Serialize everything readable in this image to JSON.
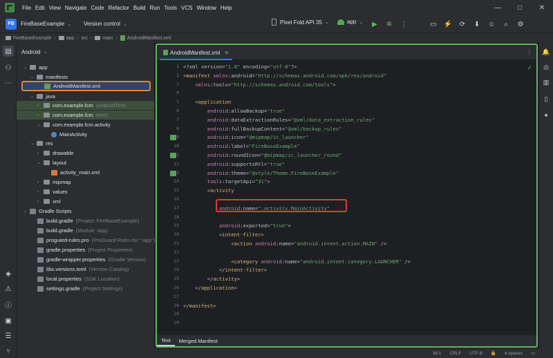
{
  "menu": [
    "File",
    "Edit",
    "View",
    "Navigate",
    "Code",
    "Refactor",
    "Build",
    "Run",
    "Tools",
    "VCS",
    "Window",
    "Help"
  ],
  "window_controls": {
    "minimize": "—",
    "maximize": "□",
    "close": "✕"
  },
  "toolbar": {
    "project_badge": "FB",
    "project_name": "FireBaseExample",
    "version_control": "Version control",
    "device": "Pixel Fold API 35",
    "run_config": "app"
  },
  "breadcrumb": [
    "FireBaseExample",
    "app",
    "src",
    "main",
    "AndroidManifest.xml"
  ],
  "project_panel": {
    "view_label": "Android",
    "tree": [
      {
        "label": "app",
        "hint": ""
      },
      {
        "label": "manifests",
        "hint": ""
      },
      {
        "label": "AndroidManifest.xml",
        "hint": ""
      },
      {
        "label": "java",
        "hint": ""
      },
      {
        "label": "com.example.fcm",
        "hint": "(androidTest)"
      },
      {
        "label": "com.example.fcm",
        "hint": "(test)"
      },
      {
        "label": "com.example.fcm.activity",
        "hint": ""
      },
      {
        "label": "MainActivity",
        "hint": ""
      },
      {
        "label": "res",
        "hint": ""
      },
      {
        "label": "drawable",
        "hint": ""
      },
      {
        "label": "layout",
        "hint": ""
      },
      {
        "label": "activity_main.xml",
        "hint": ""
      },
      {
        "label": "mipmap",
        "hint": ""
      },
      {
        "label": "values",
        "hint": ""
      },
      {
        "label": "xml",
        "hint": ""
      },
      {
        "label": "Gradle Scripts",
        "hint": ""
      },
      {
        "label": "build.gradle",
        "hint": "(Project: FireBaseExample)"
      },
      {
        "label": "build.gradle",
        "hint": "(Module :app)"
      },
      {
        "label": "proguard-rules.pro",
        "hint": "(ProGuard Rules for \":app\")"
      },
      {
        "label": "gradle.properties",
        "hint": "(Project Properties)"
      },
      {
        "label": "gradle-wrapper.properties",
        "hint": "(Gradle Version)"
      },
      {
        "label": "libs.versions.toml",
        "hint": "(Version Catalog)"
      },
      {
        "label": "local.properties",
        "hint": "(SDK Location)"
      },
      {
        "label": "settings.gradle",
        "hint": "(Project Settings)"
      }
    ]
  },
  "editor": {
    "tab_label": "AndroidManifest.xml",
    "line_numbers": [
      "1",
      "2",
      "3",
      "4",
      "5",
      "6",
      "7",
      "8",
      "9",
      "10",
      "11",
      "12",
      "13",
      "14",
      "15",
      "16",
      "17",
      "18",
      "19",
      "20",
      "21",
      "22",
      "23",
      "24",
      "25",
      "26",
      "27",
      "28",
      "29",
      "30"
    ],
    "lines": [
      "<?xml version=\"1.0\" encoding=\"utf-8\"?>",
      "<manifest xmlns:android=\"http://schemas.android.com/apk/res/android\"",
      "    xmlns:tools=\"http://schemas.android.com/tools\">",
      "",
      "    <application",
      "        android:allowBackup=\"true\"",
      "        android:dataExtractionRules=\"@xml/data_extraction_rules\"",
      "        android:fullBackupContent=\"@xml/backup_rules\"",
      "        android:icon=\"@mipmap/ic_launcher\"",
      "        android:label=\"FireBaseExample\"",
      "        android:roundIcon=\"@mipmap/ic_launcher_round\"",
      "        android:supportsRtl=\"true\"",
      "        android:theme=\"@style/Theme.FireBaseExample\"",
      "        tools:targetApi=\"31\">",
      "        <activity",
      "",
      "            android:name=\".activity.MainActivity\"",
      "",
      "            android:exported=\"true\">",
      "            <intent-filter>",
      "                <action android:name=\"android.intent.action.MAIN\" />",
      "",
      "                <category android:name=\"android.intent.category.LAUNCHER\" />",
      "            </intent-filter>",
      "        </activity>",
      "    </application>",
      "",
      "</manifest>",
      "",
      ""
    ],
    "bottom_tabs": [
      "Text",
      "Merged Manifest"
    ]
  },
  "status_bar": {
    "position": "38:1",
    "line_sep": "CRLF",
    "encoding": "UTF-8",
    "indent": "4 spaces"
  }
}
